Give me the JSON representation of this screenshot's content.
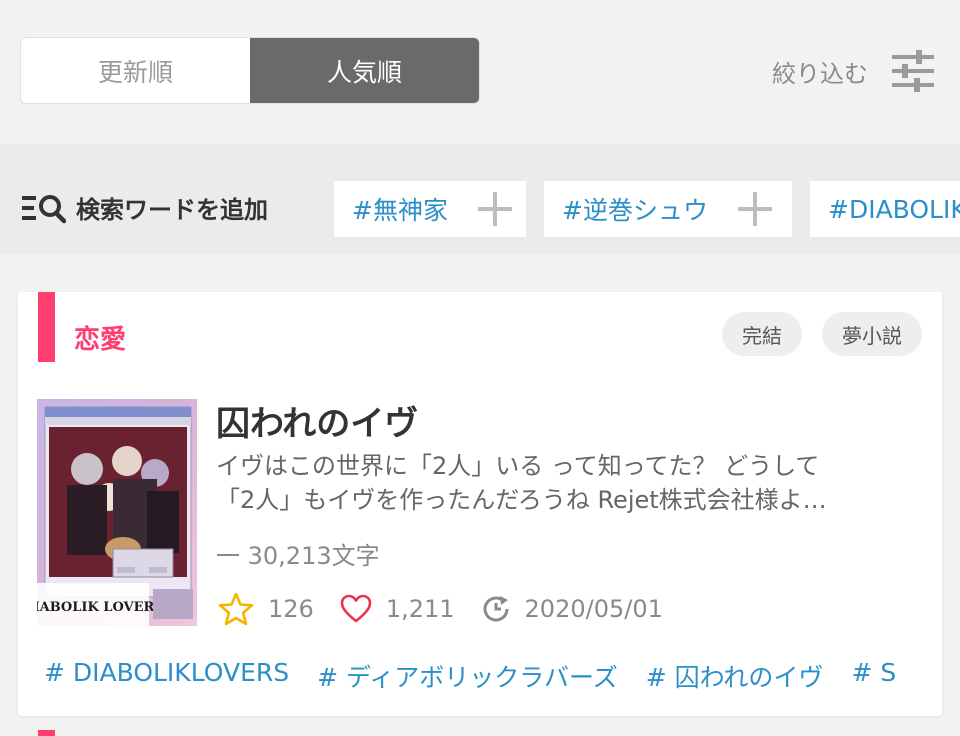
{
  "sort": {
    "newest_label": "更新順",
    "popular_label": "人気順",
    "active": "人気順",
    "filter_label": "絞り込む",
    "filter_icon": "sliders-icon"
  },
  "search_words": {
    "add_label": "検索ワードを追加",
    "add_icon": "search-list-icon",
    "chips": [
      {
        "text": "#無神家"
      },
      {
        "text": "#逆巻シュウ"
      },
      {
        "text": "#DIABOLIK"
      }
    ]
  },
  "story": {
    "genre": "恋愛",
    "genre_color": "#ff3d6e",
    "badges": [
      "完結",
      "夢小説"
    ],
    "title": "囚われのイヴ",
    "desc_line1": "イヴはこの世界に「2人」いる って知ってた？ どうして",
    "desc_line2": "「2人」もイヴを作ったんだろうね Rejet株式会社様よ…",
    "char_count": "一 30,213文字",
    "stars": "126",
    "likes": "1,211",
    "updated": "2020/05/01",
    "cover_logo": "DIABOLIK LOVERS",
    "tags": [
      "# DIABOLIKLOVERS",
      "# ディアボリックラバーズ",
      "# 囚われのイヴ",
      "# S"
    ]
  },
  "colors": {
    "accent_pink": "#ff3d6e",
    "link_blue": "#2b8fc9",
    "star_yellow": "#f5b400",
    "heart_red": "#e8334a"
  }
}
